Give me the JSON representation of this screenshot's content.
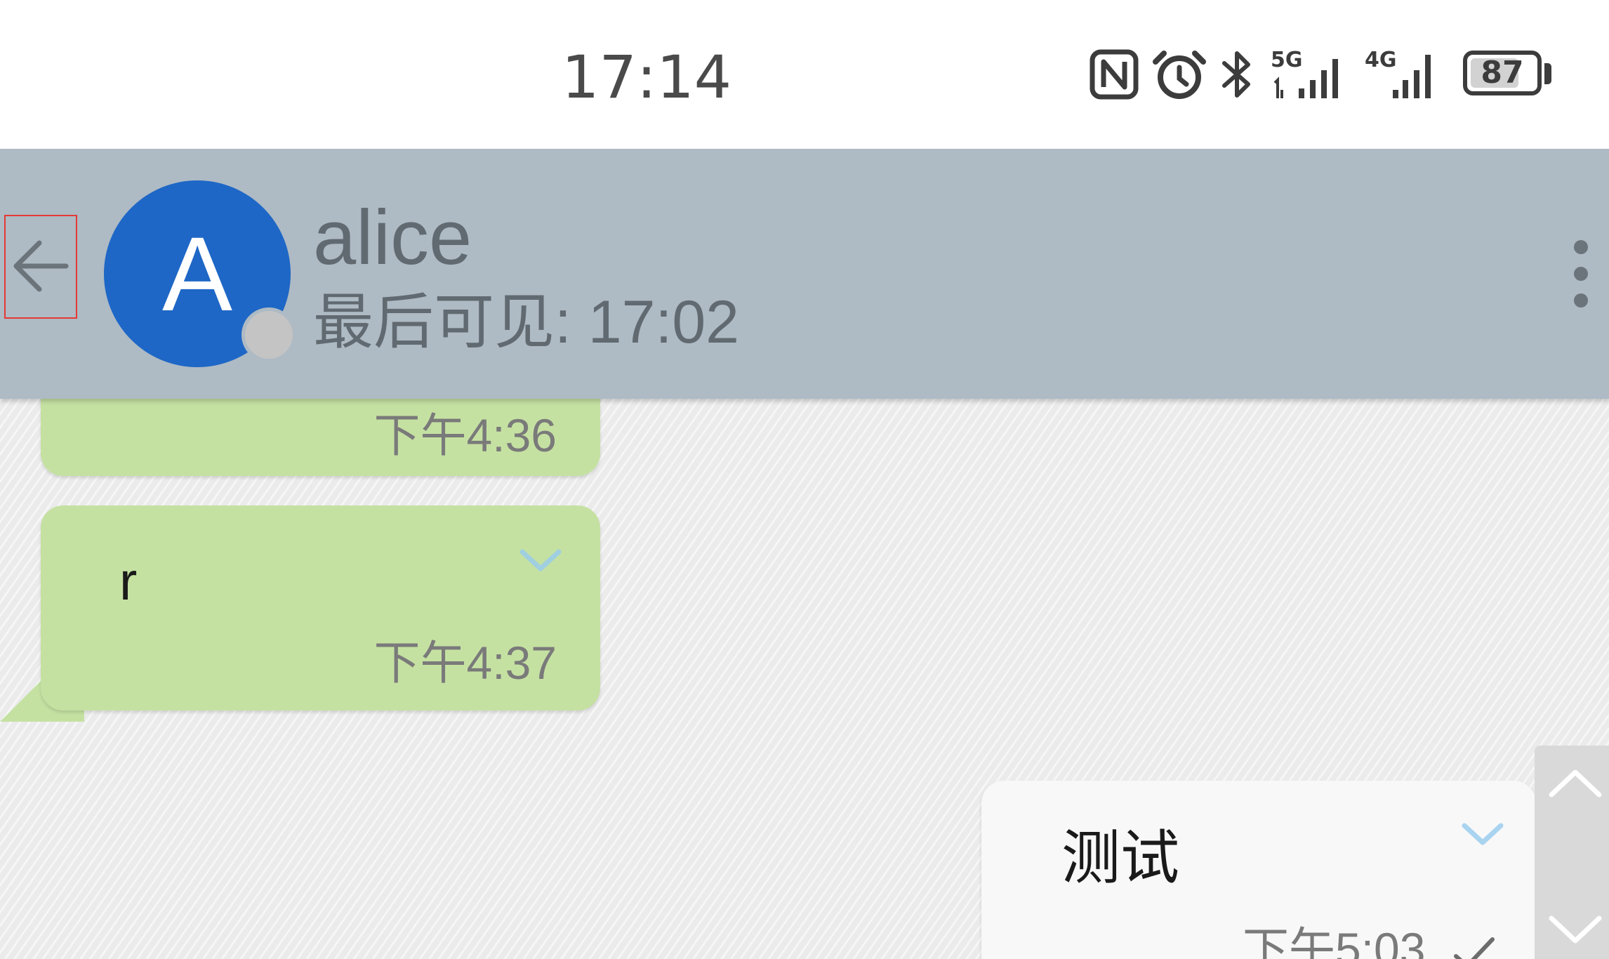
{
  "status_bar": {
    "time": "17:14",
    "icons": [
      "nfc-icon",
      "alarm-icon",
      "bluetooth-icon",
      "signal-5g-icon",
      "signal-4g-icon"
    ],
    "network_1": "5G",
    "network_2": "4G",
    "battery_percent": "87",
    "battery_level": 0.87
  },
  "header": {
    "contact_name": "alice",
    "avatar_letter": "A",
    "last_seen": "最后可见: 17:02",
    "colors": {
      "bar": "#aebac4",
      "avatar": "#1e67c6"
    }
  },
  "messages": [
    {
      "direction": "incoming",
      "text": "",
      "time": "下午4:36"
    },
    {
      "direction": "incoming",
      "text": "r",
      "time": "下午4:37"
    },
    {
      "direction": "outgoing",
      "text": "测试",
      "time": "下午5:03"
    }
  ],
  "colors": {
    "incoming_bubble": "#c5e1a2",
    "outgoing_bubble": "#f8f8f8",
    "highlight": "#e53935"
  }
}
